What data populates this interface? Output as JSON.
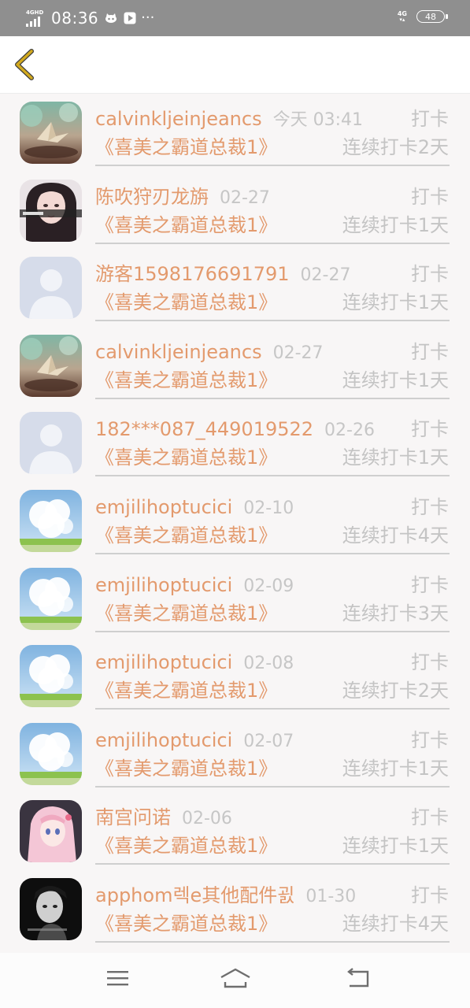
{
  "status_bar": {
    "network_label": "4GHD",
    "time": "08:36",
    "right_network": "4G",
    "battery": "48"
  },
  "header": {
    "back_icon": "chevron-left-icon"
  },
  "records": [
    {
      "name": "calvinkljeinjeancs",
      "time": "今天 03:41",
      "checkin": "打卡",
      "book": "《喜美之霸道总裁1》",
      "streak": "连续打卡2天",
      "avatar": "paper-crane"
    },
    {
      "name": "陈吹狩刃龙旃",
      "time": "02-27",
      "checkin": "打卡",
      "book": "《喜美之霸道总裁1》",
      "streak": "连续打卡1天",
      "avatar": "girl-portrait"
    },
    {
      "name": "游客1598176691791",
      "time": "02-27",
      "checkin": "打卡",
      "book": "《喜美之霸道总裁1》",
      "streak": "连续打卡1天",
      "avatar": "default-user"
    },
    {
      "name": "calvinkljeinjeancs",
      "time": "02-27",
      "checkin": "打卡",
      "book": "《喜美之霸道总裁1》",
      "streak": "连续打卡1天",
      "avatar": "paper-crane"
    },
    {
      "name": "182***087_449019522",
      "time": "02-26",
      "checkin": "打卡",
      "book": "《喜美之霸道总裁1》",
      "streak": "连续打卡1天",
      "avatar": "default-user"
    },
    {
      "name": "emjilihoptucici",
      "time": "02-10",
      "checkin": "打卡",
      "book": "《喜美之霸道总裁1》",
      "streak": "连续打卡4天",
      "avatar": "sky-cloud"
    },
    {
      "name": "emjilihoptucici",
      "time": "02-09",
      "checkin": "打卡",
      "book": "《喜美之霸道总裁1》",
      "streak": "连续打卡3天",
      "avatar": "sky-cloud"
    },
    {
      "name": "emjilihoptucici",
      "time": "02-08",
      "checkin": "打卡",
      "book": "《喜美之霸道总裁1》",
      "streak": "连续打卡2天",
      "avatar": "sky-cloud"
    },
    {
      "name": "emjilihoptucici",
      "time": "02-07",
      "checkin": "打卡",
      "book": "《喜美之霸道总裁1》",
      "streak": "连续打卡1天",
      "avatar": "sky-cloud"
    },
    {
      "name": "南宫问诺",
      "time": "02-06",
      "checkin": "打卡",
      "book": "《喜美之霸道总裁1》",
      "streak": "连续打卡1天",
      "avatar": "anime-girl"
    },
    {
      "name": "apphom렉e其他配件굀",
      "time": "01-30",
      "checkin": "打卡",
      "book": "《喜美之霸道总裁1》",
      "streak": "连续打卡4天",
      "avatar": "dark-portrait"
    }
  ],
  "nav_bar": {
    "menu_icon": "menu-icon",
    "home_icon": "home-icon",
    "back_icon": "return-icon"
  },
  "colors": {
    "accent": "#e39a6d",
    "muted": "#c4c4c4",
    "back_arrow": "#d2a91e",
    "status_bar": "#8f8f8f"
  }
}
